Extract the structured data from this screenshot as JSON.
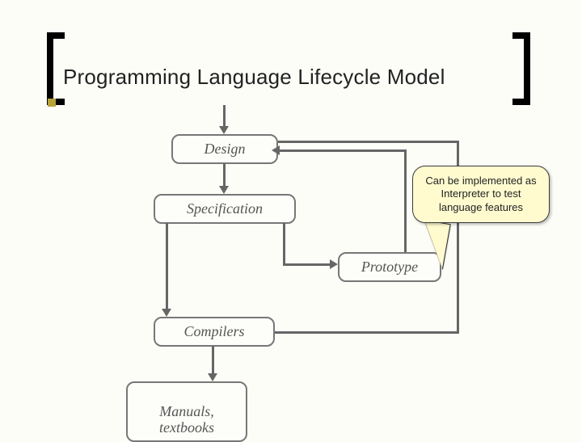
{
  "title": "Programming Language Lifecycle Model",
  "nodes": {
    "design": "Design",
    "specification": "Specification",
    "prototype": "Prototype",
    "compilers": "Compilers",
    "manuals": "Manuals,\ntextbooks"
  },
  "callout": {
    "text": "Can be implemented as Interpreter to test language features"
  }
}
